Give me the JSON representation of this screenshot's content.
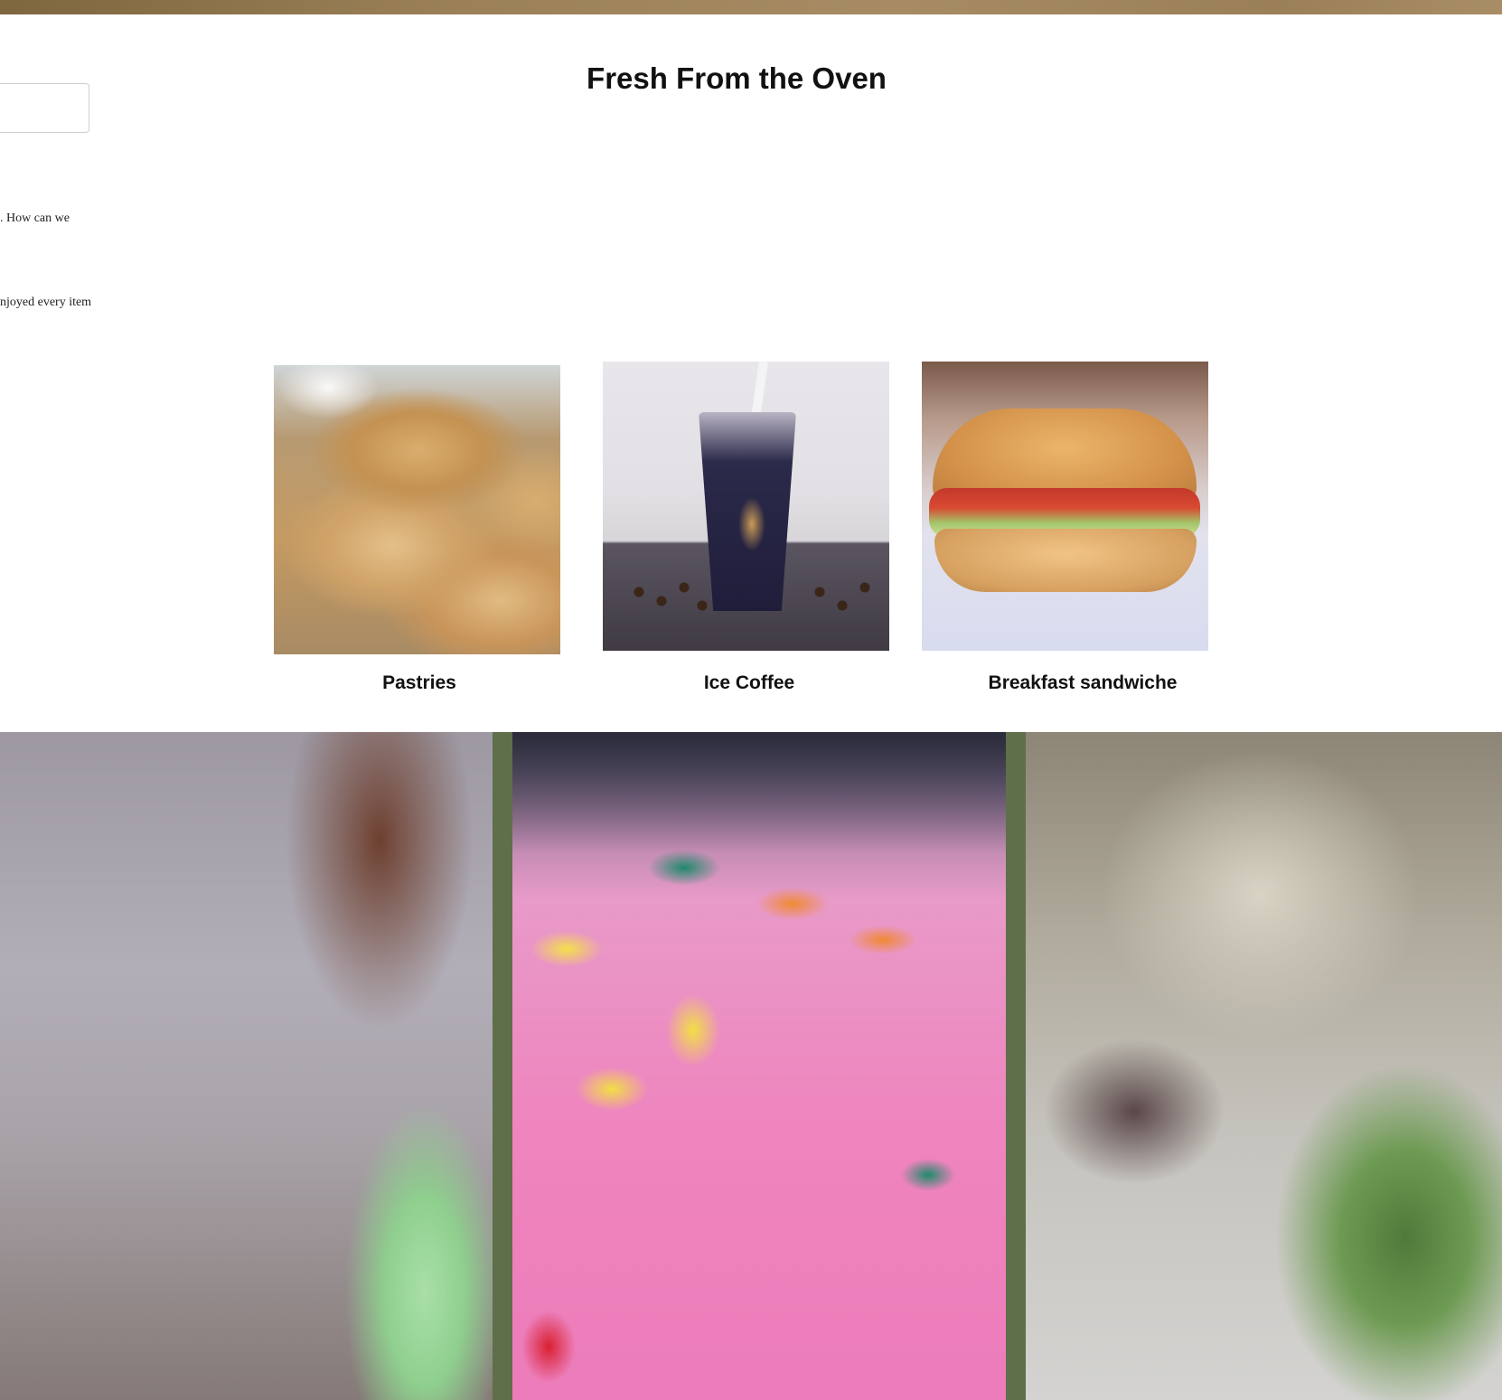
{
  "page": {
    "title": "Fresh From the Oven"
  },
  "sidebar": {
    "text_line_1": ". How can we",
    "text_line_2": "njoyed every item"
  },
  "products": [
    {
      "label": "Pastries",
      "image": "pastries-photo"
    },
    {
      "label": "Ice Coffee",
      "image": "ice-coffee-photo"
    },
    {
      "label": "Breakfast sandwiche",
      "image": "breakfast-sandwich-photo"
    }
  ],
  "gallery": [
    {
      "image": "dessert-photo-left"
    },
    {
      "image": "sprinkles-photo-middle"
    },
    {
      "image": "plated-dessert-photo-right"
    }
  ],
  "colors": {
    "top_band": "#9b8057",
    "gallery_divider": "#5f6f4a",
    "text": "#111111"
  }
}
